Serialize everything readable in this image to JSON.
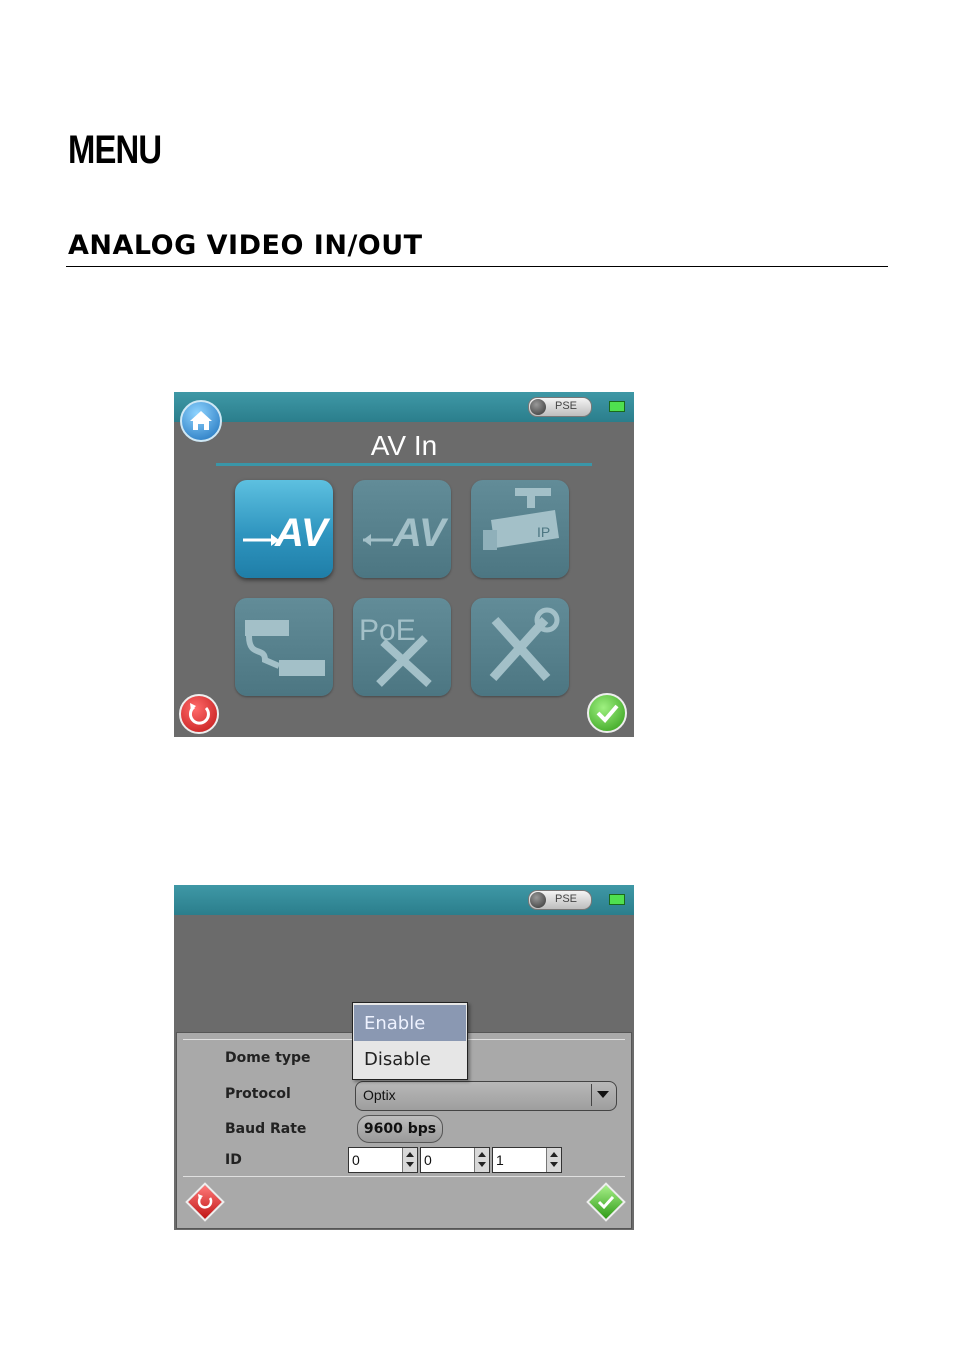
{
  "document": {
    "heading": "MENU",
    "section_heading": "ANALOG VIDEO IN/OUT"
  },
  "screen1": {
    "status_bar": {
      "pse_label": "PSE"
    },
    "title": "AV In",
    "icons": [
      {
        "name": "av-in-icon",
        "text": "AV",
        "active": true
      },
      {
        "name": "av-out-icon",
        "text": "AV",
        "active": false
      },
      {
        "name": "ip-camera-icon",
        "text": "IP",
        "active": false
      },
      {
        "name": "cable-test-icon",
        "text": "",
        "active": false
      },
      {
        "name": "poe-tools-icon",
        "text": "PoE",
        "active": false
      },
      {
        "name": "tools-icon",
        "text": "",
        "active": false
      }
    ]
  },
  "screen2": {
    "status_bar": {
      "pse_label": "PSE"
    },
    "labels": {
      "dome_type": "Dome type",
      "protocol": "Protocol",
      "baud_rate": "Baud Rate",
      "id": "ID"
    },
    "protocol_value": "Optix",
    "baud_rate_value": "9600 bps",
    "id_values": [
      "0",
      "0",
      "1"
    ],
    "dome_type_options": [
      "Enable",
      "Disable"
    ],
    "dome_type_highlighted": "Enable"
  },
  "colors": {
    "teal_bar": "#2b7e8c",
    "screen_bg": "#6b6b6b",
    "panel_bg": "#a9a9a9",
    "selected_item": "#8a98b2"
  }
}
